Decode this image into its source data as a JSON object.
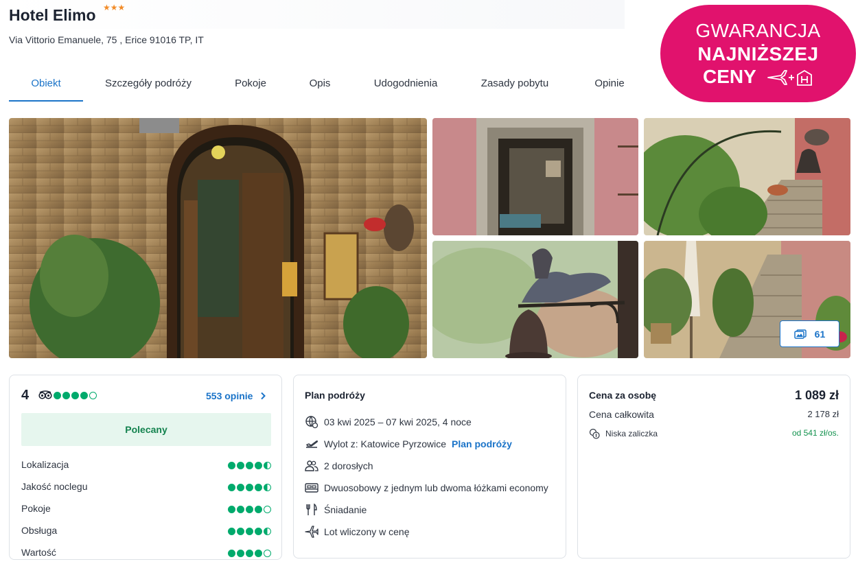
{
  "hotel": {
    "name": "Hotel Elimo",
    "stars": "★★★",
    "address": "Via Vittorio Emanuele, 75 , Erice 91016 TP, IT"
  },
  "badge": {
    "line1": "GWARANCJA",
    "line2": "NAJNIŻSZEJ",
    "line3": "CENY",
    "icons": [
      "plane-icon",
      "plus",
      "hotel-icon"
    ]
  },
  "tabs": [
    {
      "label": "Obiekt",
      "active": true
    },
    {
      "label": "Szczegóły podróży"
    },
    {
      "label": "Pokoje"
    },
    {
      "label": "Opis"
    },
    {
      "label": "Udogodnienia"
    },
    {
      "label": "Zasady pobytu"
    },
    {
      "label": "Opinie"
    }
  ],
  "gallery": {
    "photos_count": "61",
    "photos_icon": "images-icon"
  },
  "rating": {
    "score": "4",
    "score_dots": 4,
    "provider_icon": "tripadvisor-icon",
    "reviews_link": "553 opinie",
    "recommended": "Polecany",
    "categories": [
      {
        "label": "Lokalizacja",
        "value": 4.5
      },
      {
        "label": "Jakość noclegu",
        "value": 4.5
      },
      {
        "label": "Pokoje",
        "value": 4
      },
      {
        "label": "Obsługa",
        "value": 4.5
      },
      {
        "label": "Wartość",
        "value": 4
      }
    ]
  },
  "plan": {
    "title": "Plan podróży",
    "dates": "03 kwi 2025 – 07 kwi 2025, 4 noce",
    "departure": "Wylot z: Katowice Pyrzowice",
    "departure_link": "Plan podróży",
    "guests": "2 dorosłych",
    "room": "Dwuosobowy z jednym lub dwoma łóżkami economy",
    "board": "Śniadanie",
    "flight": "Lot wliczony w cenę"
  },
  "price": {
    "per_person_label": "Cena za osobę",
    "per_person_value": "1 089 zł",
    "total_label": "Cena całkowita",
    "total_value": "2 178 zł",
    "deposit_label": "Niska zaliczka",
    "deposit_value": "od 541 zł/os."
  },
  "colors": {
    "accent": "#1a73c8",
    "badge": "#e1126d",
    "rating_green": "#00aa6c",
    "recommended_bg": "#e6f6ee"
  }
}
